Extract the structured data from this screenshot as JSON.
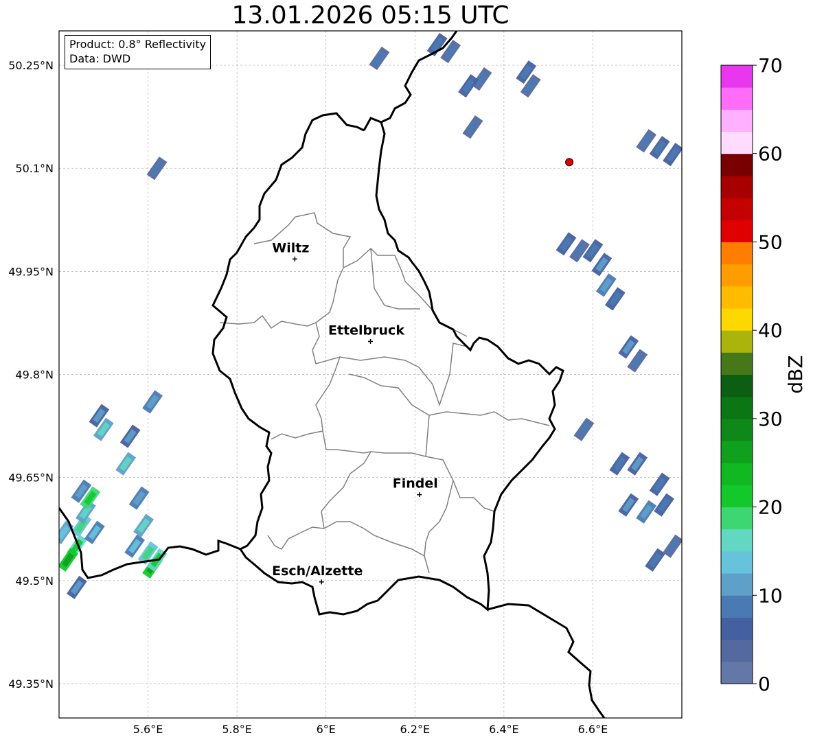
{
  "title": "13.01.2026 05:15 UTC",
  "info": {
    "product": "Product: 0.8° Reflectivity",
    "data": "Data: DWD"
  },
  "map": {
    "lon_range": [
      5.4,
      6.8
    ],
    "lat_range": [
      49.3,
      50.3
    ],
    "x_ticks": [
      {
        "value": 5.6,
        "label": "5.6°E"
      },
      {
        "value": 5.8,
        "label": "5.8°E"
      },
      {
        "value": 6.0,
        "label": "6°E"
      },
      {
        "value": 6.2,
        "label": "6.2°E"
      },
      {
        "value": 6.4,
        "label": "6.4°E"
      },
      {
        "value": 6.6,
        "label": "6.6°E"
      }
    ],
    "y_ticks": [
      {
        "value": 50.25,
        "label": "50.25°N"
      },
      {
        "value": 50.1,
        "label": "50.1°N"
      },
      {
        "value": 49.95,
        "label": "49.95°N"
      },
      {
        "value": 49.8,
        "label": "49.8°N"
      },
      {
        "value": 49.65,
        "label": "49.65°N"
      },
      {
        "value": 49.5,
        "label": "49.5°N"
      },
      {
        "value": 49.35,
        "label": "49.35°N"
      }
    ],
    "cities": [
      {
        "name": "Wiltz",
        "lon": 5.93,
        "lat": 49.968
      },
      {
        "name": "Ettelbruck",
        "lon": 6.1,
        "lat": 49.848
      },
      {
        "name": "Findel",
        "lon": 6.21,
        "lat": 49.625
      },
      {
        "name": "Esch/Alzette",
        "lon": 5.99,
        "lat": 49.498
      }
    ],
    "radar_site": {
      "lon": 6.547,
      "lat": 50.109,
      "color": "#e00000"
    }
  },
  "colorbar": {
    "label": "dBZ",
    "min": 0,
    "max": 70,
    "ticks": [
      "0",
      "10",
      "20",
      "30",
      "40",
      "50",
      "60",
      "70"
    ],
    "colors": [
      "#6478a8",
      "#5469a0",
      "#4560a0",
      "#4a7ab3",
      "#5ea0c8",
      "#67c3dc",
      "#62d8c2",
      "#3ed672",
      "#12c82a",
      "#12b822",
      "#10a01e",
      "#0e8818",
      "#0a7614",
      "#0b5e12",
      "#46781a",
      "#aab40a",
      "#ffd800",
      "#ffbb00",
      "#ff9c00",
      "#ff7d00",
      "#e00000",
      "#c40000",
      "#a60000",
      "#780000",
      "#ffdcff",
      "#ffb0ff",
      "#ff6cf8",
      "#e837ee"
    ]
  },
  "radar_echoes": [
    {
      "lon": 6.6,
      "lat": 49.98,
      "dbz": 5
    },
    {
      "lon": 6.62,
      "lat": 49.96,
      "dbz": 6
    },
    {
      "lon": 6.63,
      "lat": 49.93,
      "dbz": 8
    },
    {
      "lon": 6.65,
      "lat": 49.91,
      "dbz": 5
    },
    {
      "lon": 6.57,
      "lat": 49.98,
      "dbz": 4
    },
    {
      "lon": 6.54,
      "lat": 49.99,
      "dbz": 5
    },
    {
      "lon": 6.68,
      "lat": 49.84,
      "dbz": 6
    },
    {
      "lon": 6.7,
      "lat": 49.82,
      "dbz": 4
    },
    {
      "lon": 6.75,
      "lat": 50.13,
      "dbz": 5
    },
    {
      "lon": 6.72,
      "lat": 50.14,
      "dbz": 4
    },
    {
      "lon": 6.78,
      "lat": 50.12,
      "dbz": 5
    },
    {
      "lon": 6.7,
      "lat": 49.67,
      "dbz": 6
    },
    {
      "lon": 6.66,
      "lat": 49.67,
      "dbz": 5
    },
    {
      "lon": 6.75,
      "lat": 49.64,
      "dbz": 5
    },
    {
      "lon": 6.72,
      "lat": 49.6,
      "dbz": 8
    },
    {
      "lon": 6.68,
      "lat": 49.61,
      "dbz": 6
    },
    {
      "lon": 6.76,
      "lat": 49.61,
      "dbz": 5
    },
    {
      "lon": 6.74,
      "lat": 49.53,
      "dbz": 5
    },
    {
      "lon": 6.78,
      "lat": 49.55,
      "dbz": 4
    },
    {
      "lon": 6.58,
      "lat": 49.72,
      "dbz": 4
    },
    {
      "lon": 6.35,
      "lat": 50.23,
      "dbz": 4
    },
    {
      "lon": 6.32,
      "lat": 50.22,
      "dbz": 5
    },
    {
      "lon": 6.45,
      "lat": 50.24,
      "dbz": 5
    },
    {
      "lon": 6.46,
      "lat": 50.22,
      "dbz": 4
    },
    {
      "lon": 6.25,
      "lat": 50.28,
      "dbz": 5
    },
    {
      "lon": 6.28,
      "lat": 50.27,
      "dbz": 4
    },
    {
      "lon": 6.12,
      "lat": 50.26,
      "dbz": 4
    },
    {
      "lon": 6.33,
      "lat": 50.16,
      "dbz": 4
    },
    {
      "lon": 5.62,
      "lat": 50.1,
      "dbz": 4
    },
    {
      "lon": 5.45,
      "lat": 49.58,
      "dbz": 14
    },
    {
      "lon": 5.44,
      "lat": 49.55,
      "dbz": 17
    },
    {
      "lon": 5.42,
      "lat": 49.53,
      "dbz": 22
    },
    {
      "lon": 5.46,
      "lat": 49.6,
      "dbz": 12
    },
    {
      "lon": 5.48,
      "lat": 49.57,
      "dbz": 9
    },
    {
      "lon": 5.41,
      "lat": 49.57,
      "dbz": 10
    },
    {
      "lon": 5.45,
      "lat": 49.63,
      "dbz": 8
    },
    {
      "lon": 5.47,
      "lat": 49.62,
      "dbz": 18
    },
    {
      "lon": 5.61,
      "lat": 49.52,
      "dbz": 22
    },
    {
      "lon": 5.6,
      "lat": 49.54,
      "dbz": 14
    },
    {
      "lon": 5.59,
      "lat": 49.58,
      "dbz": 11
    },
    {
      "lon": 5.58,
      "lat": 49.62,
      "dbz": 8
    },
    {
      "lon": 5.57,
      "lat": 49.55,
      "dbz": 9
    },
    {
      "lon": 5.62,
      "lat": 49.53,
      "dbz": 16
    },
    {
      "lon": 5.5,
      "lat": 49.72,
      "dbz": 11
    },
    {
      "lon": 5.49,
      "lat": 49.74,
      "dbz": 7
    },
    {
      "lon": 5.55,
      "lat": 49.67,
      "dbz": 12
    },
    {
      "lon": 5.56,
      "lat": 49.71,
      "dbz": 6
    },
    {
      "lon": 5.61,
      "lat": 49.76,
      "dbz": 8
    },
    {
      "lon": 5.44,
      "lat": 49.49,
      "dbz": 7
    }
  ]
}
